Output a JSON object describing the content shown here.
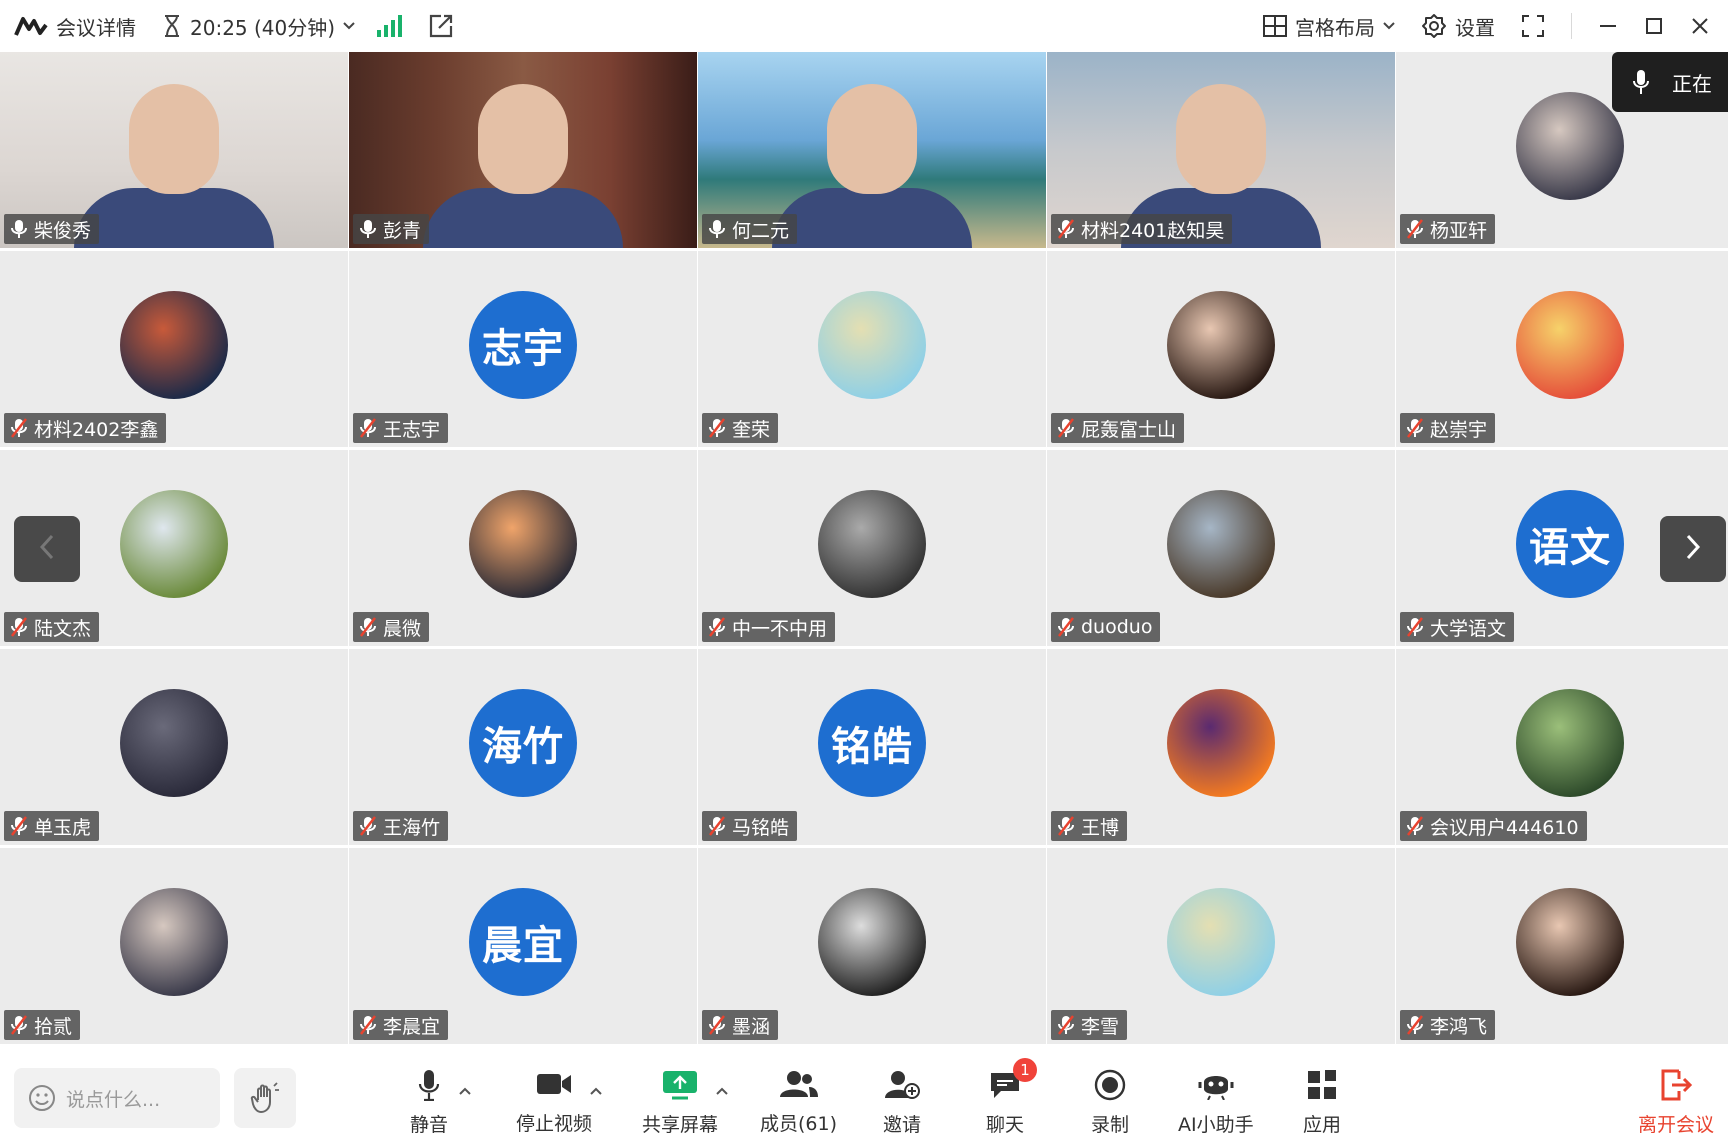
{
  "topbar": {
    "meeting_details": "会议详情",
    "time": "20:25 (40分钟)",
    "layout_label": "宫格布局",
    "settings_label": "设置"
  },
  "speaking": {
    "label": "正在"
  },
  "tiles": [
    {
      "name": "柴俊秀",
      "type": "video",
      "mic": "on"
    },
    {
      "name": "彭青",
      "type": "video",
      "mic": "on",
      "active": true
    },
    {
      "name": "何二元",
      "type": "video",
      "mic": "on"
    },
    {
      "name": "材料2401赵知昊",
      "type": "video",
      "mic": "muted"
    },
    {
      "name": "杨亚轩",
      "type": "avatar",
      "mic": "muted"
    },
    {
      "name": "材料2402李鑫",
      "type": "avatar",
      "mic": "muted"
    },
    {
      "name": "王志宇",
      "type": "text",
      "avatar_text": "志宇",
      "mic": "muted"
    },
    {
      "name": "奎荣",
      "type": "avatar",
      "mic": "muted"
    },
    {
      "name": "屁轰富士山",
      "type": "avatar",
      "mic": "muted"
    },
    {
      "name": "赵崇宇",
      "type": "avatar",
      "mic": "muted"
    },
    {
      "name": "陆文杰",
      "type": "avatar",
      "mic": "muted"
    },
    {
      "name": "晨微",
      "type": "avatar",
      "mic": "muted"
    },
    {
      "name": "中一不中用",
      "type": "avatar",
      "mic": "muted"
    },
    {
      "name": "duoduo",
      "type": "avatar",
      "mic": "muted"
    },
    {
      "name": "大学语文",
      "type": "text",
      "avatar_text": "语文",
      "mic": "muted"
    },
    {
      "name": "单玉虎",
      "type": "avatar",
      "mic": "muted"
    },
    {
      "name": "王海竹",
      "type": "text",
      "avatar_text": "海竹",
      "mic": "muted"
    },
    {
      "name": "马铭皓",
      "type": "text",
      "avatar_text": "铭皓",
      "mic": "muted"
    },
    {
      "name": "王博",
      "type": "avatar",
      "mic": "muted"
    },
    {
      "name": "会议用户444610",
      "type": "avatar",
      "mic": "muted"
    },
    {
      "name": "拾贰",
      "type": "avatar",
      "mic": "muted"
    },
    {
      "name": "李晨宜",
      "type": "text",
      "avatar_text": "晨宜",
      "mic": "muted"
    },
    {
      "name": "墨涵",
      "type": "avatar",
      "mic": "muted"
    },
    {
      "name": "李雪",
      "type": "avatar",
      "mic": "muted"
    },
    {
      "name": "李鸿飞",
      "type": "avatar",
      "mic": "muted"
    }
  ],
  "bottombar": {
    "chat_placeholder": "说点什么...",
    "mute": "静音",
    "stop_video": "停止视频",
    "share_screen": "共享屏幕",
    "members": "成员(61)",
    "invite": "邀请",
    "chat": "聊天",
    "chat_badge": "1",
    "record": "录制",
    "ai_assistant": "AI小助手",
    "apps": "应用",
    "leave": "离开会议"
  },
  "colors": {
    "accent_blue": "#1e6ed0",
    "active_border": "#3ec47a",
    "signal_green": "#19b26b",
    "leave_red": "#e8432f"
  }
}
